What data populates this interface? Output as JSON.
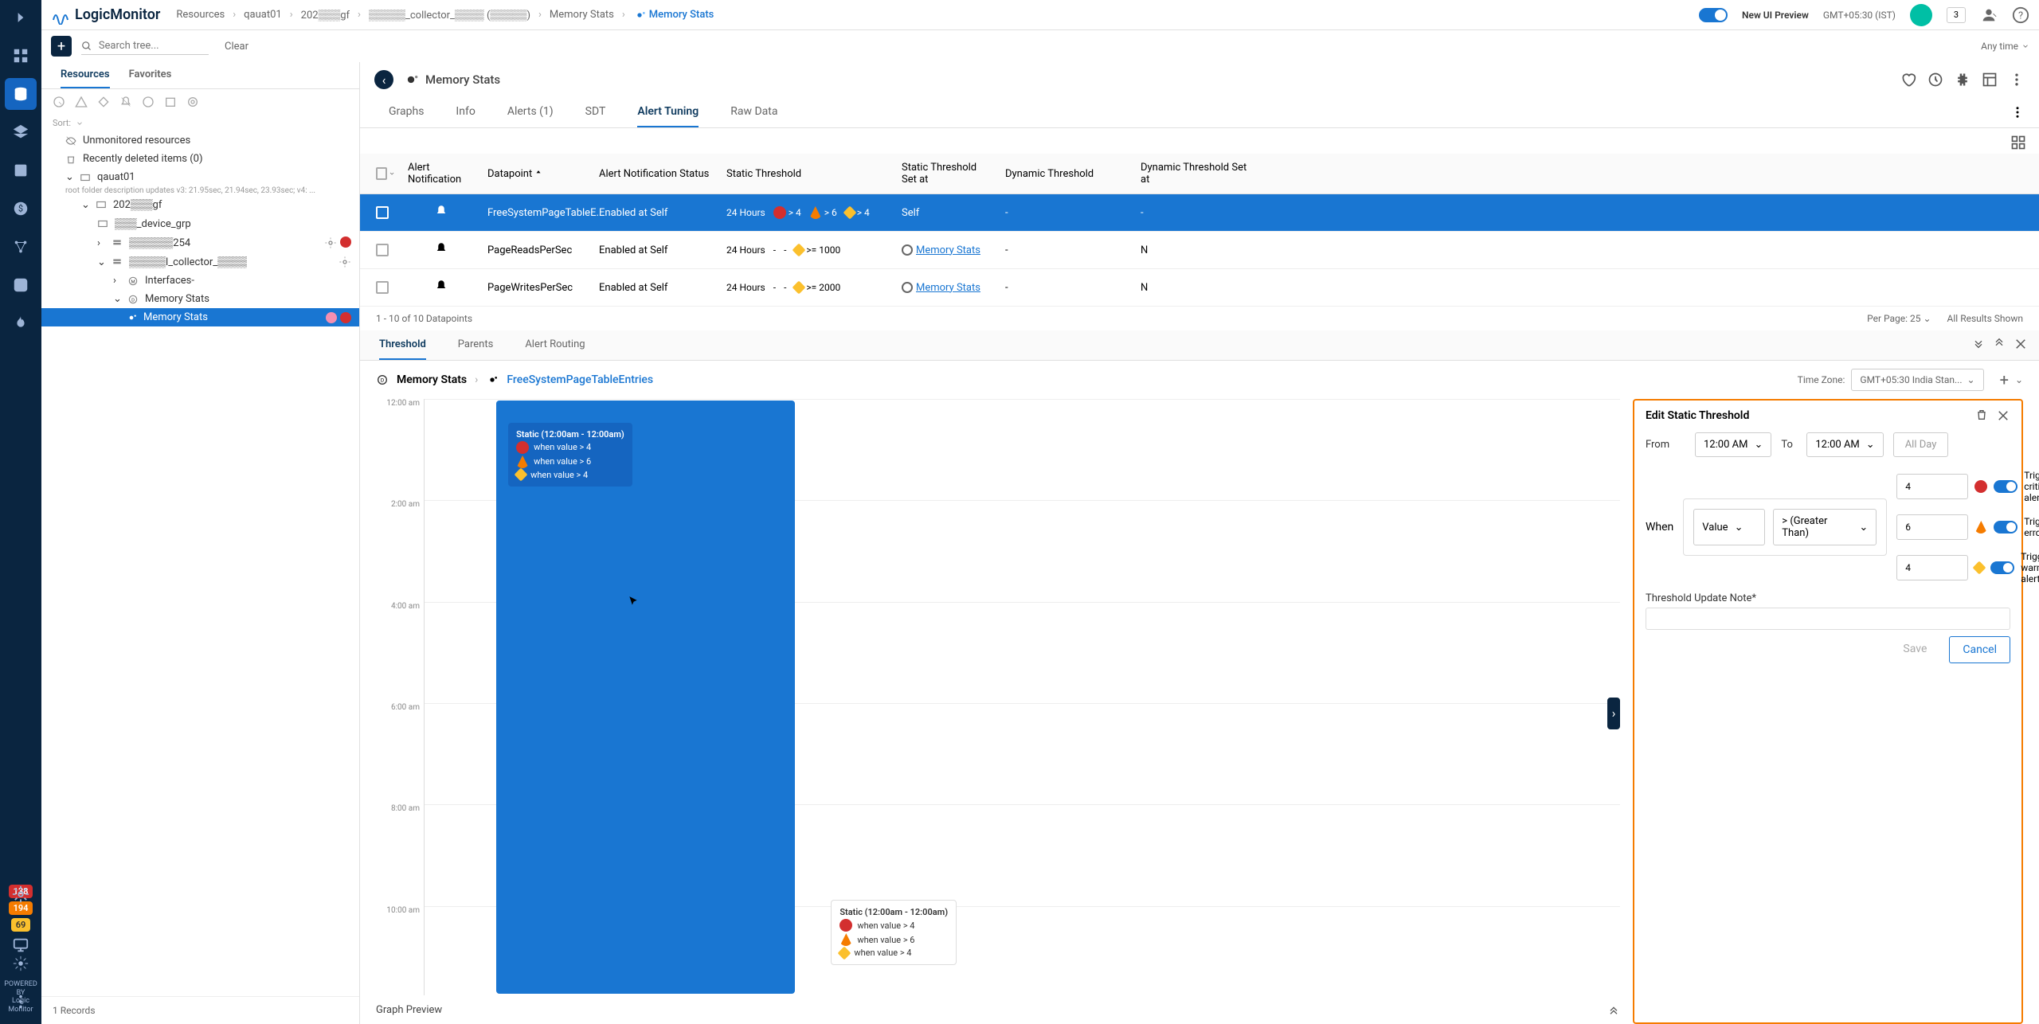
{
  "logo_text": "LogicMonitor",
  "powered_by": "POWERED BY",
  "logo_foot1": "Logic",
  "logo_foot2": "Monitor",
  "breadcrumb": [
    "Resources",
    "qauat01",
    "202▒▒▒gf",
    "▒▒▒▒▒_collector_▒▒▒▒ (▒▒▒▒▒)",
    "Memory Stats",
    "Memory Stats"
  ],
  "new_ui": "New UI Preview",
  "tz_top": "GMT+05:30 (IST)",
  "notif_count": "3",
  "toolbar": {
    "search_placeholder": "Search tree...",
    "clear": "Clear",
    "anytime": "Any time"
  },
  "tree_tabs": {
    "resources": "Resources",
    "favorites": "Favorites"
  },
  "sort_label": "Sort:",
  "tree": {
    "unmonitored": "Unmonitored resources",
    "deleted": "Recently deleted items (0)",
    "root": "qauat01",
    "root_sub": "root folder description updates v3: 21.95sec, 21.94sec, 23.93sec; v4: ...",
    "grp1": "202▒▒▒gf",
    "grp2": "▒▒▒_device_grp",
    "grp3": "▒▒▒▒▒▒254",
    "grp4": "▒▒▒▒▒l_collector_▒▒▒▒",
    "sub1": "Interfaces-",
    "sub2": "Memory Stats",
    "sub3": "Memory Stats"
  },
  "tree_footer": "1 Records",
  "main": {
    "title": "Memory Stats",
    "tabs": [
      "Graphs",
      "Info",
      "Alerts (1)",
      "SDT",
      "Alert Tuning",
      "Raw Data"
    ]
  },
  "dp": {
    "head": [
      "",
      "",
      "Alert Notification",
      "Datapoint",
      "Alert Notification Status",
      "Static Threshold",
      "Static Threshold Set at",
      "Dynamic Threshold",
      "Dynamic Threshold Set at"
    ],
    "rows": [
      {
        "dp": "FreeSystemPageTableE...",
        "status": "Enabled at Self",
        "hours": "24 Hours",
        "t1": "> 4",
        "t2": "> 6",
        "t3": "> 4",
        "setat": "Self",
        "dyn": "-",
        "dynat": "-"
      },
      {
        "dp": "PageReadsPerSec",
        "status": "Enabled at Self",
        "hours": "24 Hours",
        "t1": "-",
        "t2": "-",
        "t3": ">= 1000",
        "setat": "Memory Stats",
        "dyn": "-",
        "dynat": "N"
      },
      {
        "dp": "PageWritesPerSec",
        "status": "Enabled at Self",
        "hours": "24 Hours",
        "t1": "-",
        "t2": "-",
        "t3": ">= 2000",
        "setat": "Memory Stats",
        "dyn": "-",
        "dynat": "N"
      }
    ],
    "foot_range": "1 - 10 of 10 Datapoints",
    "per_page": "Per Page: 25",
    "all_shown": "All Results Shown"
  },
  "detail_tabs": [
    "Threshold",
    "Parents",
    "Alert Routing"
  ],
  "detail_head": {
    "parent": "Memory Stats",
    "dp": "FreeSystemPageTableEntries",
    "tz_label": "Time Zone:",
    "tz_val": "GMT+05:30 India Stan..."
  },
  "graph": {
    "ticks": [
      "12:00 am",
      "2:00 am",
      "4:00 am",
      "6:00 am",
      "8:00 am",
      "10:00 am"
    ],
    "tooltip_title": "Static (12:00am - 12:00am)",
    "tt_rows": [
      "when value > 4",
      "when value > 6",
      "when value > 4"
    ],
    "tooltip2_title": "Static (12:00am - 12:00am)",
    "tt2_rows": [
      "when value > 4",
      "when value > 6",
      "when value > 4"
    ],
    "preview": "Graph Preview"
  },
  "edit": {
    "title": "Edit Static Threshold",
    "from": "From",
    "from_val": "12:00 AM",
    "to": "To",
    "to_val": "12:00 AM",
    "allday": "All Day",
    "when": "When",
    "value": "Value",
    "op": "> (Greater Than)",
    "crit_val": "4",
    "crit_lab": "Trigger a critical alert",
    "err_val": "6",
    "err_lab": "Trigger an error alert",
    "warn_val": "4",
    "warn_lab": "Trigger a warning alert",
    "note": "Threshold Update Note*",
    "save": "Save",
    "cancel": "Cancel"
  },
  "nav_badges": {
    "red": "138",
    "orange": "194",
    "yellow": "69"
  }
}
